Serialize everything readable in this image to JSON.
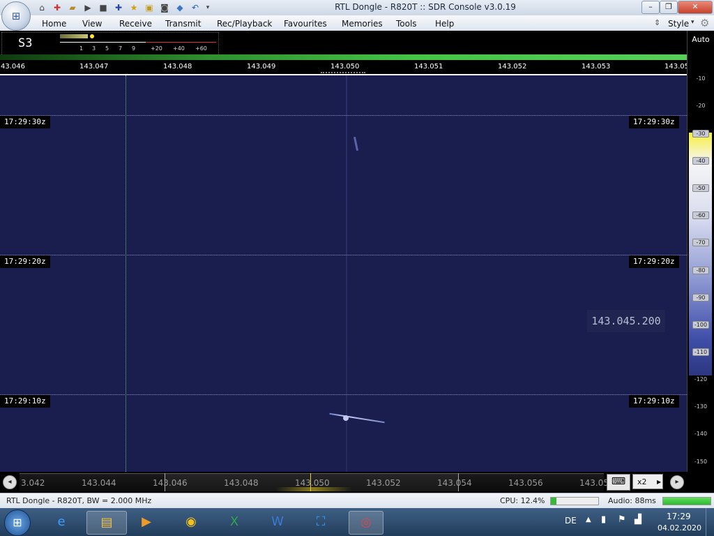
{
  "window": {
    "title": "RTL Dongle - R820T :: SDR Console v3.0.19",
    "minimize": "–",
    "maximize": "❐",
    "close": "✕"
  },
  "menu": [
    "Home",
    "View",
    "Receive",
    "Transmit",
    "Rec/Playback",
    "Favourites",
    "Memories",
    "Tools",
    "Help"
  ],
  "style_label": "Style",
  "smeter": {
    "value": "S3",
    "scale": [
      "1",
      "3",
      "5",
      "7",
      "9",
      "+20",
      "+40",
      "+60"
    ]
  },
  "spectrum_axis": [
    "43.046",
    "143.047",
    "143.048",
    "143.049",
    "143.050",
    "143.051",
    "143.052",
    "143.053",
    "143.05"
  ],
  "timestamps": [
    "17:29:30z",
    "17:29:20z",
    "17:29:10z"
  ],
  "vfo_readout": "143.045.200",
  "db_scale": {
    "auto_label": "Auto",
    "ticks": [
      "-10",
      "-20",
      "-30",
      "-40",
      "-50",
      "-60",
      "-70",
      "-80",
      "-90",
      "-100",
      "-110",
      "-120",
      "-130",
      "-140",
      "-150"
    ]
  },
  "overview_axis": [
    "3.042",
    "143.044",
    "143.046",
    "143.048",
    "143.050",
    "143.052",
    "143.054",
    "143.056",
    "143.05"
  ],
  "zoom": "x2",
  "status": {
    "device": "RTL Dongle - R820T, BW = 2.000 MHz",
    "cpu": "CPU: 12.4%",
    "cpu_level": 0.124,
    "audio": "Audio: 88ms"
  },
  "taskbar": {
    "language": "DE",
    "time": "17:29",
    "date": "04.02.2020"
  }
}
